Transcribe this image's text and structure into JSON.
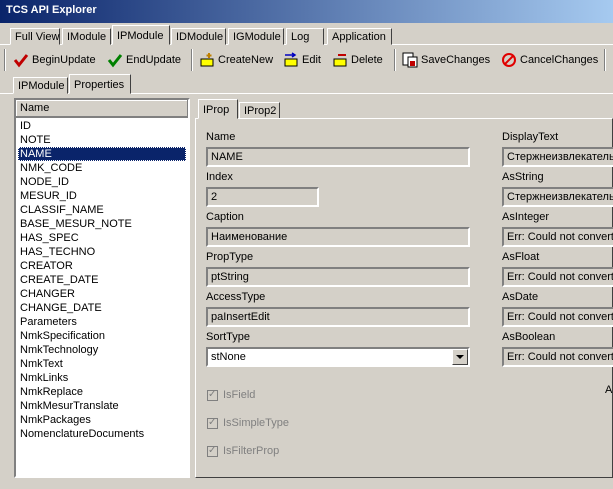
{
  "app": {
    "title": "TCS API Explorer"
  },
  "main_tabs": [
    "Full View",
    "IModule",
    "IPModule",
    "IDModule",
    "IGModule",
    "Log",
    "Application"
  ],
  "toolbar": {
    "begin_update": "BeginUpdate",
    "end_update": "EndUpdate",
    "create_new": "CreateNew",
    "edit": "Edit",
    "delete": "Delete",
    "save_changes": "SaveChanges",
    "cancel_changes": "CancelChanges"
  },
  "sub_tabs": [
    "IPModule",
    "Properties"
  ],
  "list": {
    "header": "Name",
    "items": [
      "ID",
      "NOTE",
      "NAME",
      "NMK_CODE",
      "NODE_ID",
      "MESUR_ID",
      "CLASSIF_NAME",
      "BASE_MESUR_NOTE",
      "HAS_SPEC",
      "HAS_TECHNO",
      "CREATOR",
      "CREATE_DATE",
      "CHANGER",
      "CHANGE_DATE",
      "Parameters",
      "NmkSpecification",
      "NmkTechnology",
      "NmkText",
      "NmkLinks",
      "NmkReplace",
      "NmkMesurTranslate",
      "NmkPackages",
      "NomenclatureDocuments"
    ],
    "selected": "NAME"
  },
  "prop_tabs": [
    "IProp",
    "IProp2"
  ],
  "props": {
    "name_label": "Name",
    "name_value": "NAME",
    "index_label": "Index",
    "index_value": "2",
    "caption_label": "Caption",
    "caption_value": "Наименование",
    "proptype_label": "PropType",
    "proptype_value": "ptString",
    "accesstype_label": "AccessType",
    "accesstype_value": "paInsertEdit",
    "sorttype_label": "SortType",
    "sorttype_value": "stNone",
    "isfield_label": "IsField",
    "issimpletype_label": "IsSimpleType",
    "isfilterprop_label": "IsFilterProp"
  },
  "right_props": {
    "displaytext_label": "DisplayText",
    "displaytext_value": "Стержнеизвлекатель",
    "asstring_label": "AsString",
    "asstring_value": "Стержнеизвлекатель",
    "asinteger_label": "AsInteger",
    "asinteger_value": "Err: Could not convert v",
    "asfloat_label": "AsFloat",
    "asfloat_value": "Err: Could not convert v",
    "asdate_label": "AsDate",
    "asdate_value": "Err: Could not convert v",
    "asboolean_label": "AsBoolean",
    "asboolean_value": "Err: Could not convert v",
    "cut_label": "A"
  },
  "colors": {
    "titlebar_start": "#0a246a",
    "titlebar_end": "#a6caf0",
    "selection": "#0a246a",
    "face": "#d4d0c8"
  }
}
